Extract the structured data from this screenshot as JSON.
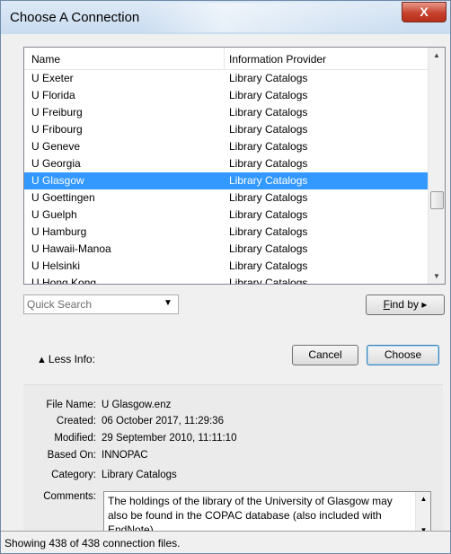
{
  "window": {
    "title": "Choose A Connection",
    "close_glyph": "X"
  },
  "list": {
    "columns": [
      "Name",
      "Information Provider"
    ],
    "rows": [
      {
        "name": "U Exeter",
        "provider": "Library Catalogs"
      },
      {
        "name": "U Florida",
        "provider": "Library Catalogs"
      },
      {
        "name": "U Freiburg",
        "provider": "Library Catalogs"
      },
      {
        "name": "U Fribourg",
        "provider": "Library Catalogs"
      },
      {
        "name": "U Geneve",
        "provider": "Library Catalogs"
      },
      {
        "name": "U Georgia",
        "provider": "Library Catalogs"
      },
      {
        "name": "U Glasgow",
        "provider": "Library Catalogs"
      },
      {
        "name": "U Goettingen",
        "provider": "Library Catalogs"
      },
      {
        "name": "U Guelph",
        "provider": "Library Catalogs"
      },
      {
        "name": "U Hamburg",
        "provider": "Library Catalogs"
      },
      {
        "name": "U Hawaii-Manoa",
        "provider": "Library Catalogs"
      },
      {
        "name": "U Helsinki",
        "provider": "Library Catalogs"
      },
      {
        "name": "U Hong Kong",
        "provider": "Library Catalogs"
      }
    ],
    "selected_index": 6,
    "selection_color": "#3399ff"
  },
  "search": {
    "placeholder": "Quick Search",
    "dropdown_icon": "dropdown-arrow-icon"
  },
  "buttons": {
    "find_by": "Find by",
    "find_by_arrow": "▸",
    "less_info": "Less Info:",
    "less_info_icon": "up-arrow-icon",
    "cancel": "Cancel",
    "choose": "Choose"
  },
  "info": {
    "file_name_label": "File Name:",
    "file_name": "U Glasgow.enz",
    "created_label": "Created:",
    "created": "06 October 2017, 11:29:36",
    "modified_label": "Modified:",
    "modified": "29 September 2010, 11:11:10",
    "based_on_label": "Based On:",
    "based_on": "INNOPAC",
    "category_label": "Category:",
    "category": "Library Catalogs",
    "comments_label": "Comments:",
    "comments": "The holdings of the library of the University of Glasgow may also be found in the COPAC database (also included with EndNote)."
  },
  "status": {
    "text": "Showing 438 of 438 connection files."
  }
}
